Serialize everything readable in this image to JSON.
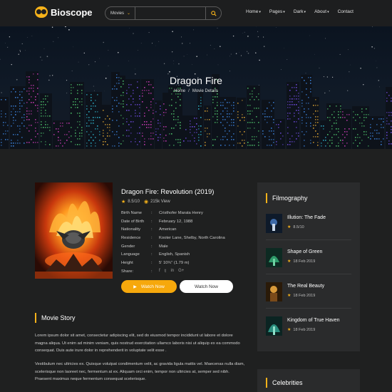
{
  "header": {
    "logo_text": "Bioscope",
    "search_category": "Movies",
    "search_placeholder": "",
    "nav": [
      {
        "label": "Home",
        "has_dropdown": true
      },
      {
        "label": "Pages",
        "has_dropdown": true
      },
      {
        "label": "Dark",
        "has_dropdown": true
      },
      {
        "label": "About",
        "has_dropdown": true
      },
      {
        "label": "Contact",
        "has_dropdown": false
      }
    ]
  },
  "hero": {
    "title": "Dragon Fire",
    "breadcrumb": {
      "home": "Home",
      "separator": "/",
      "current": "Movie Details"
    }
  },
  "movie": {
    "title": "Dragon Fire: Revolution (2019)",
    "rating": "8.5/10",
    "views": "215k View",
    "details": [
      {
        "key": "Birth Name",
        "value": "Cristhofer Marata Henry"
      },
      {
        "key": "Date of Birth",
        "value": "February 12, 1988"
      },
      {
        "key": "Nationality",
        "value": "American"
      },
      {
        "key": "Residence",
        "value": "Kooter Lane, Shelby, North Carolina"
      },
      {
        "key": "Gender",
        "value": "Male"
      },
      {
        "key": "Language",
        "value": "English, Spanish"
      },
      {
        "key": "Height",
        "value": "5' 10¾\" (1.79 m)"
      }
    ],
    "share_label": "Share:",
    "share_separator": ":",
    "watch_button_primary": "Watch Now",
    "watch_button_secondary": "Watch Now"
  },
  "story": {
    "heading": "Movie Story",
    "paragraph1": "Lorem ipsum dolor sit amet, consectetur adipiscing elit, sed do eiusmod tempor incididunt ut labore et dolore magna aliqua. Ut enim ad minim veniam, quis nostrud exercitation ullamco laboris nisi ut aliquip ex ea commodo consequat. Duis aute irure dolor in reprehenderit in voluptate velit esse .",
    "paragraph2": "Vestibulum nec ultricies ex. Quisque volutpat condimentum velit, ac gravida ligula mattis vel. Maecenas nulla diam, scelerisque non laoreet nec, fermentum at ex. Aliquam orci enim, tempor non ultricies at, semper sed nibh. Praesent maximus neque fermentum consequat scelerisque."
  },
  "filmography": {
    "heading": "Filmography",
    "items": [
      {
        "title": "Illution: The Fade",
        "sub": "8.5/10",
        "has_star": true
      },
      {
        "title": "Shape of Green",
        "sub": "18 Feb 2019",
        "has_star": true
      },
      {
        "title": "The Real Beauty",
        "sub": "18 Feb 2019",
        "has_star": true
      },
      {
        "title": "Kingdom of True Haven",
        "sub": "18 Feb 2019",
        "has_star": true
      }
    ]
  },
  "celebrities": {
    "heading": "Celebrities"
  },
  "colors": {
    "accent": "#f6b21a",
    "background": "#1f2020",
    "panel": "#2a2b2c"
  }
}
